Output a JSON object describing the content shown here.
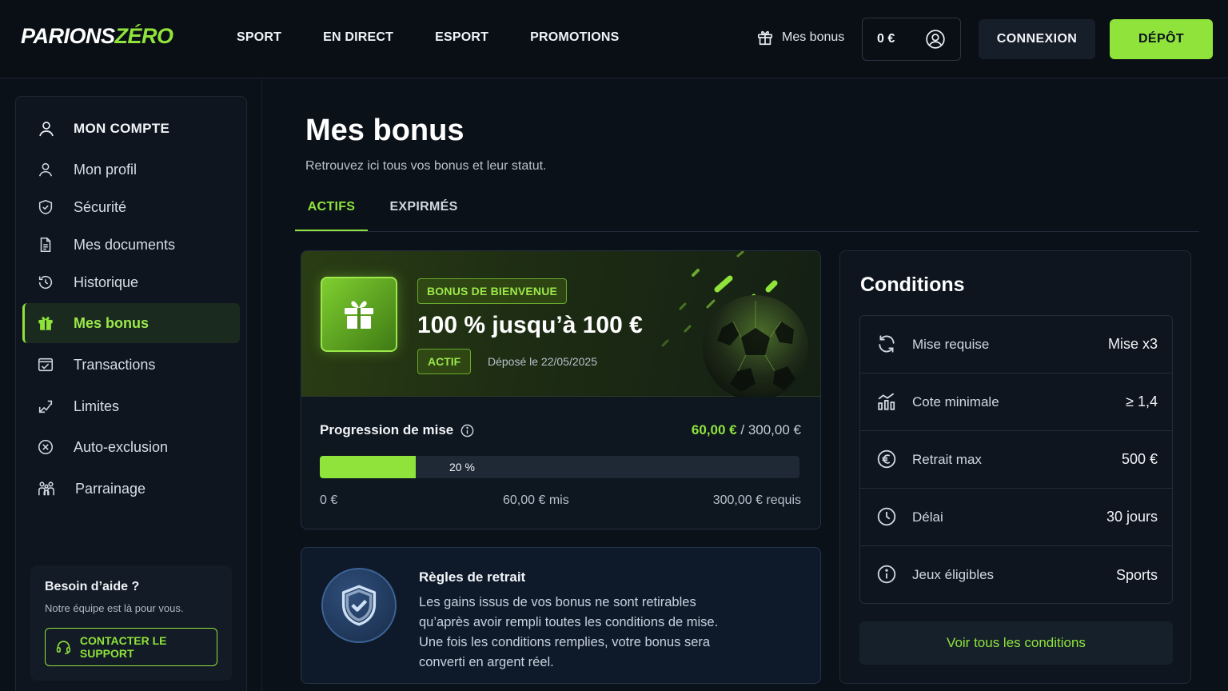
{
  "header": {
    "logo_part1": "PARIONS",
    "logo_part2": "ZÉRO",
    "nav": [
      "SPORT",
      "EN DIRECT",
      "ESPORT",
      "PROMOTIONS"
    ],
    "bonus_link": "Mes bonus",
    "balance": "0 €",
    "login_label": "CONNEXION",
    "deposit_label": "DÉPÔT"
  },
  "sidebar": {
    "heading": "MON COMPTE",
    "items": [
      {
        "label": "Mon profil",
        "icon": "user-icon"
      },
      {
        "label": "Sécurité",
        "icon": "shield-icon"
      },
      {
        "label": "Mes documents",
        "icon": "document-icon"
      },
      {
        "label": "Historique",
        "icon": "history-icon"
      },
      {
        "label": "Mes bonus",
        "icon": "gift-icon",
        "active": true
      },
      {
        "label": "Transactions",
        "icon": "transactions-icon"
      },
      {
        "label": "Limites",
        "icon": "limits-icon"
      },
      {
        "label": "Auto-exclusion",
        "icon": "exclusion-icon"
      },
      {
        "label": "Parrainage",
        "icon": "referral-icon"
      }
    ],
    "help": {
      "title": "Besoin d’aide ?",
      "subtitle": "Notre équipe est là pour vous.",
      "button": "CONTACTER LE SUPPORT"
    }
  },
  "page": {
    "title": "Mes bonus",
    "subtitle": "Retrouvez ici tous vos bonus et leur statut.",
    "tabs": [
      {
        "label": "ACTIFS",
        "active": true
      },
      {
        "label": "EXPIRMÉS",
        "active": false
      }
    ]
  },
  "bonus": {
    "tag": "BONUS DE BIENVENUE",
    "amount": "100 % jusqu’à 100 €",
    "status": "ACTIF",
    "deposit_date": "Déposé le 22/05/2025",
    "progress": {
      "label": "Progression de mise",
      "current": "60,00 €",
      "total": "/ 300,00 €",
      "percent_label": "20 %",
      "fraction": 0.2,
      "min_label": "0 €",
      "mid_label": "60,00 € mis",
      "max_label": "300,00 € requis"
    }
  },
  "rules": {
    "title": "Règles de retrait",
    "text": "Les gains issus de vos bonus ne sont retirables qu’après avoir rempli toutes les conditions de mise. Une fois les conditions remplies, votre bonus sera converti en argent réel."
  },
  "conditions": {
    "title": "Conditions",
    "rows": [
      {
        "label": "Mise requise",
        "value": "Mise x3",
        "icon": "refresh-icon"
      },
      {
        "label": "Cote minimale",
        "value": "≥ 1,4",
        "icon": "chart-icon"
      },
      {
        "label": "Retrait max",
        "value": "500 €",
        "icon": "euro-icon"
      },
      {
        "label": "Délai",
        "value": "30 jours",
        "icon": "clock-icon"
      },
      {
        "label": "Jeux éligibles",
        "value": "Sports",
        "icon": "info-icon"
      }
    ],
    "button": "Voir tous les conditions"
  },
  "colors": {
    "accent": "#8fe33b",
    "background": "#0b1119",
    "panel": "#0e151f"
  }
}
